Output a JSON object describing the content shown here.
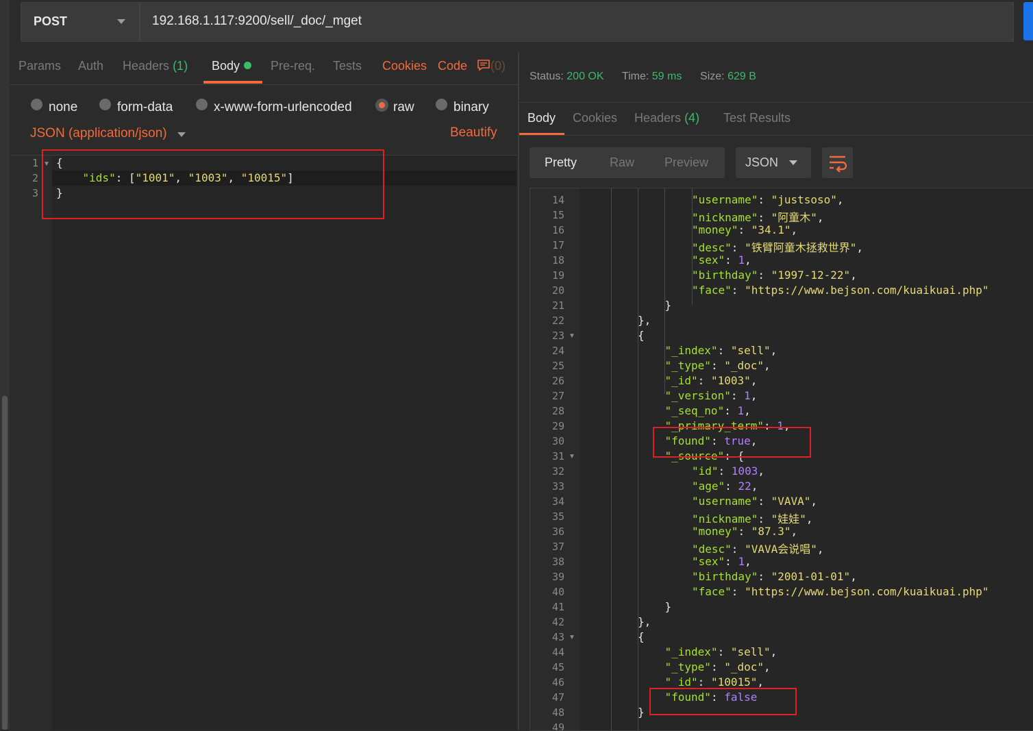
{
  "request": {
    "method": "POST",
    "url": "192.168.1.117:9200/sell/_doc/_mget"
  },
  "request_tabs": {
    "params": "Params",
    "auth": "Auth",
    "headers": "Headers",
    "headers_count": "(1)",
    "body": "Body",
    "prereq": "Pre-req.",
    "tests": "Tests",
    "cookies": "Cookies",
    "code": "Code",
    "comments_count": "(0)"
  },
  "body_types": {
    "none": "none",
    "form_data": "form-data",
    "urlencoded": "x-www-form-urlencoded",
    "raw": "raw",
    "binary": "binary",
    "selected": "raw"
  },
  "content_type": "JSON (application/json)",
  "beautify": "Beautify",
  "request_body": {
    "line_numbers": [
      "1",
      "2",
      "3"
    ],
    "key": "\"ids\"",
    "values": [
      "\"1001\"",
      "\"1003\"",
      "\"10015\""
    ]
  },
  "response_status": {
    "status_label": "Status:",
    "status_value": "200 OK",
    "time_label": "Time:",
    "time_value": "59 ms",
    "size_label": "Size:",
    "size_value": "629 B"
  },
  "response_tabs": {
    "body": "Body",
    "cookies": "Cookies",
    "headers": "Headers",
    "headers_count": "(4)",
    "test_results": "Test Results"
  },
  "view_modes": {
    "pretty": "Pretty",
    "raw": "Raw",
    "preview": "Preview",
    "language": "JSON"
  },
  "response_lines": [
    {
      "n": "14",
      "indent": 4,
      "k": "\"username\"",
      "v": "\"justsoso\"",
      "t": "s",
      "end": ","
    },
    {
      "n": "15",
      "indent": 4,
      "k": "\"nickname\"",
      "v": "\"阿童木\"",
      "t": "s",
      "end": ","
    },
    {
      "n": "16",
      "indent": 4,
      "k": "\"money\"",
      "v": "\"34.1\"",
      "t": "s",
      "end": ","
    },
    {
      "n": "17",
      "indent": 4,
      "k": "\"desc\"",
      "v": "\"铁臂阿童木拯救世界\"",
      "t": "s",
      "end": ","
    },
    {
      "n": "18",
      "indent": 4,
      "k": "\"sex\"",
      "v": "1",
      "t": "n",
      "end": ","
    },
    {
      "n": "19",
      "indent": 4,
      "k": "\"birthday\"",
      "v": "\"1997-12-22\"",
      "t": "s",
      "end": ","
    },
    {
      "n": "20",
      "indent": 4,
      "k": "\"face\"",
      "v": "\"https://www.bejson.com/kuaikuai.php\"",
      "t": "s",
      "end": ""
    },
    {
      "n": "21",
      "indent": 3,
      "raw": "}"
    },
    {
      "n": "22",
      "indent": 2,
      "raw": "},"
    },
    {
      "n": "23",
      "indent": 2,
      "raw": "{",
      "fold": true
    },
    {
      "n": "24",
      "indent": 3,
      "k": "\"_index\"",
      "v": "\"sell\"",
      "t": "s",
      "end": ","
    },
    {
      "n": "25",
      "indent": 3,
      "k": "\"_type\"",
      "v": "\"_doc\"",
      "t": "s",
      "end": ","
    },
    {
      "n": "26",
      "indent": 3,
      "k": "\"_id\"",
      "v": "\"1003\"",
      "t": "s",
      "end": ","
    },
    {
      "n": "27",
      "indent": 3,
      "k": "\"_version\"",
      "v": "1",
      "t": "n",
      "end": ","
    },
    {
      "n": "28",
      "indent": 3,
      "k": "\"_seq_no\"",
      "v": "1",
      "t": "n",
      "end": ","
    },
    {
      "n": "29",
      "indent": 3,
      "k": "\"_primary_term\"",
      "v": "1",
      "t": "n",
      "end": ","
    },
    {
      "n": "30",
      "indent": 3,
      "k": "\"found\"",
      "v": "true",
      "t": "n",
      "end": ","
    },
    {
      "n": "31",
      "indent": 3,
      "k": "\"_source\"",
      "v": "{",
      "t": "p",
      "end": "",
      "fold": true
    },
    {
      "n": "32",
      "indent": 4,
      "k": "\"id\"",
      "v": "1003",
      "t": "n",
      "end": ","
    },
    {
      "n": "33",
      "indent": 4,
      "k": "\"age\"",
      "v": "22",
      "t": "n",
      "end": ","
    },
    {
      "n": "34",
      "indent": 4,
      "k": "\"username\"",
      "v": "\"VAVA\"",
      "t": "s",
      "end": ","
    },
    {
      "n": "35",
      "indent": 4,
      "k": "\"nickname\"",
      "v": "\"娃娃\"",
      "t": "s",
      "end": ","
    },
    {
      "n": "36",
      "indent": 4,
      "k": "\"money\"",
      "v": "\"87.3\"",
      "t": "s",
      "end": ","
    },
    {
      "n": "37",
      "indent": 4,
      "k": "\"desc\"",
      "v": "\"VAVA会说唱\"",
      "t": "s",
      "end": ","
    },
    {
      "n": "38",
      "indent": 4,
      "k": "\"sex\"",
      "v": "1",
      "t": "n",
      "end": ","
    },
    {
      "n": "39",
      "indent": 4,
      "k": "\"birthday\"",
      "v": "\"2001-01-01\"",
      "t": "s",
      "end": ","
    },
    {
      "n": "40",
      "indent": 4,
      "k": "\"face\"",
      "v": "\"https://www.bejson.com/kuaikuai.php\"",
      "t": "s",
      "end": ""
    },
    {
      "n": "41",
      "indent": 3,
      "raw": "}"
    },
    {
      "n": "42",
      "indent": 2,
      "raw": "},"
    },
    {
      "n": "43",
      "indent": 2,
      "raw": "{",
      "fold": true
    },
    {
      "n": "44",
      "indent": 3,
      "k": "\"_index\"",
      "v": "\"sell\"",
      "t": "s",
      "end": ","
    },
    {
      "n": "45",
      "indent": 3,
      "k": "\"_type\"",
      "v": "\"_doc\"",
      "t": "s",
      "end": ","
    },
    {
      "n": "46",
      "indent": 3,
      "k": "\"_id\"",
      "v": "\"10015\"",
      "t": "s",
      "end": ","
    },
    {
      "n": "47",
      "indent": 3,
      "k": "\"found\"",
      "v": "false",
      "t": "n",
      "end": ""
    },
    {
      "n": "48",
      "indent": 2,
      "raw": "}"
    }
  ],
  "colors": {
    "accent": "#f26b3a",
    "success": "#3dba6c",
    "json_key": "#a6e22e",
    "json_string": "#e6db74",
    "json_number": "#ae81ff",
    "highlight_box": "#e02020"
  }
}
